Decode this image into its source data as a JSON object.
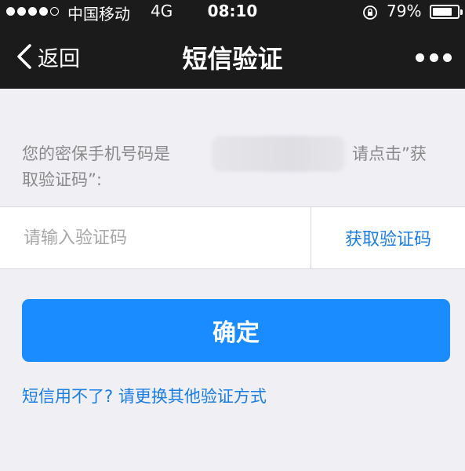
{
  "status_bar": {
    "signal_bars": 5,
    "signal_filled": 4,
    "carrier": "中国移动",
    "network": "4G",
    "time": "08:10",
    "battery_percent": "79%",
    "battery_level": 0.79,
    "lock_icon": "orientation-lock-icon"
  },
  "nav": {
    "back_label": "返回",
    "back_icon": "chevron-left-icon",
    "title": "短信验证",
    "more_icon": "more-dots-icon"
  },
  "notice": {
    "prefix": "您的密保手机号码是",
    "suffix": "请点击”获",
    "line2": "取验证码”:"
  },
  "code_input": {
    "value": "",
    "placeholder": "请输入验证码"
  },
  "get_code_label": "获取验证码",
  "confirm_label": "确定",
  "alt_link": "短信用不了? 请更换其他验证方式",
  "colors": {
    "topbar": "#1b1b1b",
    "background": "#efeff4",
    "primary": "#1a8cff",
    "link": "#1a7de3",
    "hint": "#8a8a8a"
  }
}
